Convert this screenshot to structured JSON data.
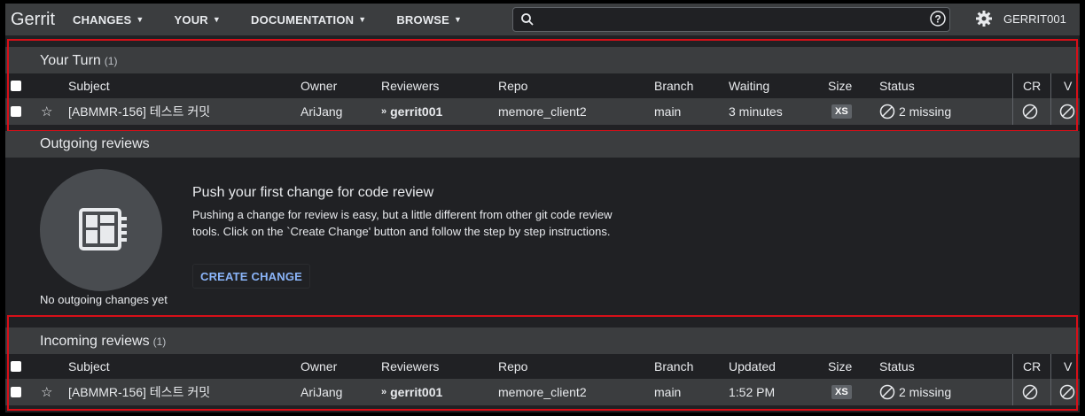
{
  "header": {
    "logo": "Gerrit",
    "nav": [
      {
        "label": "CHANGES"
      },
      {
        "label": "YOUR"
      },
      {
        "label": "DOCUMENTATION"
      },
      {
        "label": "BROWSE"
      }
    ],
    "search_placeholder": "",
    "user": "GERRIT001"
  },
  "columns": {
    "subject": "Subject",
    "owner": "Owner",
    "reviewers": "Reviewers",
    "repo": "Repo",
    "branch": "Branch",
    "waiting": "Waiting",
    "updated": "Updated",
    "size": "Size",
    "status": "Status",
    "cr": "CR",
    "v": "V"
  },
  "your_turn": {
    "title": "Your Turn",
    "count": "(1)",
    "rows": [
      {
        "subject": "[ABMMR-156] 테스트 커밋",
        "owner": "AriJang",
        "reviewer": "gerrit001",
        "repo": "memore_client2",
        "branch": "main",
        "time": "3 minutes",
        "size": "XS",
        "status": "2 missing"
      }
    ]
  },
  "outgoing": {
    "title": "Outgoing reviews",
    "empty_label": "No outgoing changes yet",
    "push_title": "Push your first change for code review",
    "push_desc": "Pushing a change for review is easy, but a little different from other git code review tools. Click on the `Create Change' button and follow the step by step instructions.",
    "create_button": "CREATE CHANGE"
  },
  "incoming": {
    "title": "Incoming reviews",
    "count": "(1)",
    "rows": [
      {
        "subject": "[ABMMR-156] 테스트 커밋",
        "owner": "AriJang",
        "reviewer": "gerrit001",
        "repo": "memore_client2",
        "branch": "main",
        "time": "1:52 PM",
        "size": "XS",
        "status": "2 missing"
      }
    ]
  },
  "colors": {
    "accent": "#8ab4f8",
    "highlight": "#d70f18",
    "surface": "#3b3d3f",
    "background": "#202124"
  }
}
